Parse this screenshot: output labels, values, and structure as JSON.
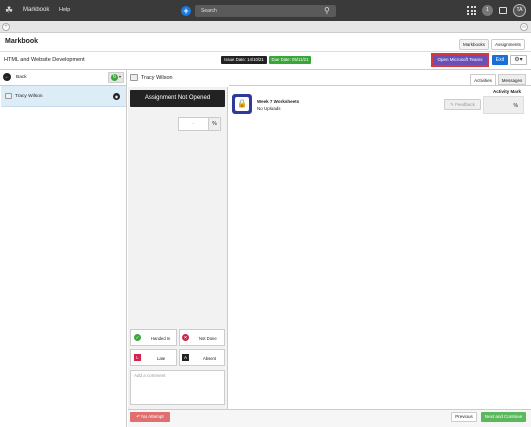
{
  "topbar": {
    "brand": "Markbook",
    "help": "Help",
    "search_placeholder": "Search",
    "notifications": "1",
    "avatar": "TA"
  },
  "header": {
    "page_title": "Markbook",
    "tabs": [
      "Markbooks",
      "Assignments"
    ],
    "course": "HTML and Website Development",
    "issue_date": "Issue Date: 14/10/21",
    "due_date": "Due Date: 05/11/21",
    "teams_button": "Open Microsoft Teams",
    "exit_button": "Exit"
  },
  "sidebar": {
    "back": "Back",
    "students": [
      {
        "name": "Tracy Wilson"
      }
    ]
  },
  "student_panel": {
    "name": "Tracy Wilson",
    "status": "Assignment Not Opened",
    "mark_placeholder": "-",
    "mark_unit": "%",
    "status_buttons": {
      "handed_in": "Handed In",
      "not_done": "Not Done",
      "late": "Late",
      "absent": "Absent"
    },
    "comment_placeholder": "Add a comment"
  },
  "activities": {
    "tabs": [
      "Activities",
      "Messages"
    ],
    "mark_header": "Activity Mark",
    "items": [
      {
        "title": "Week 7 Worksheets",
        "subtitle": "No Uploads",
        "feedback": "Feedback",
        "mark_unit": "%"
      }
    ]
  },
  "footer": {
    "no_attempt": "No Attempt",
    "previous": "Previous",
    "next_continue": "Next and Continue"
  },
  "colors": {
    "topbar": "#3a3a3a",
    "issue_badge": "#222222",
    "due_badge": "#3aa63a",
    "teams": "#6a4fb8",
    "exit": "#1a6fd6",
    "selected_row": "#dcedf8",
    "next": "#5cb85c",
    "no_attempt": "#e07070"
  }
}
